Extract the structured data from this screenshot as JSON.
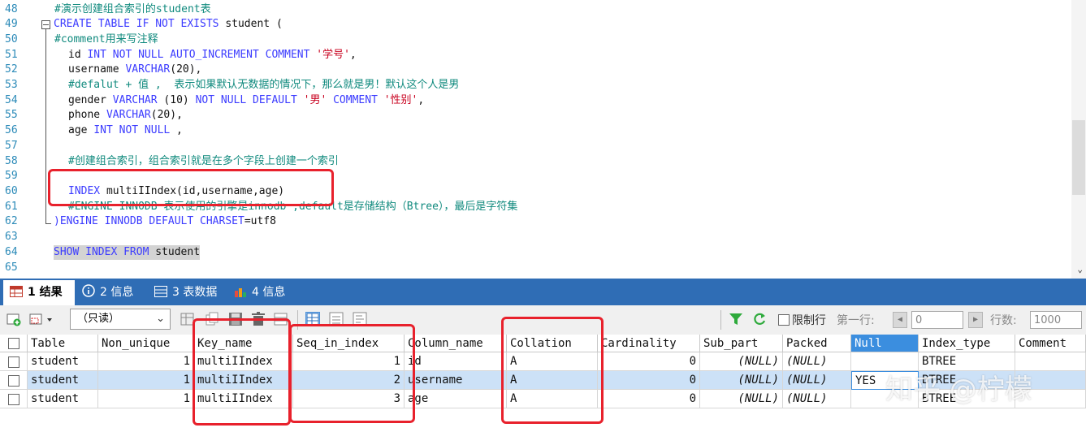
{
  "editor": {
    "line_numbers": [
      "48",
      "49",
      "50",
      "51",
      "52",
      "53",
      "54",
      "55",
      "56",
      "57",
      "58",
      "59",
      "60",
      "61",
      "62",
      "63",
      "64",
      "65"
    ],
    "lines": {
      "l48": "#演示创建组合索引的student表",
      "l49_kw": "CREATE TABLE IF NOT EXISTS",
      "l49_rest": " student (",
      "l50": "#comment用来写注释",
      "l51_a": "id ",
      "l51_kw": "INT NOT NULL AUTO_INCREMENT COMMENT",
      "l51_str": "'学号'",
      "l51_end": ",",
      "l52_a": "username ",
      "l52_kw": "VARCHAR",
      "l52_end": "(20),",
      "l53": "#defalut + 值 ,  表示如果默认无数据的情况下，那么就是男！默认这个人是男",
      "l54_a": "gender ",
      "l54_kw1": "VARCHAR",
      "l54_b": " (10) ",
      "l54_kw2": "NOT NULL DEFAULT",
      "l54_str1": "'男'",
      "l54_kw3": "COMMENT",
      "l54_str2": "'性别'",
      "l54_end": ",",
      "l55_a": "phone ",
      "l55_kw": "VARCHAR",
      "l55_end": "(20),",
      "l56_a": "age ",
      "l56_kw": "INT NOT NULL",
      "l56_end": " ,",
      "l58": "#创建组合索引，组合索引就是在多个字段上创建一个索引",
      "l60_kw": "INDEX",
      "l60_rest": " multiIIndex(id,username,age)",
      "l61": "#ENGINE INNODB 表示使用的引擎是innodb ,default是存储结构（Btree），最后是字符集",
      "l62_a": ")",
      "l62_kw": "ENGINE INNODB DEFAULT CHARSET",
      "l62_end": "=utf8",
      "l64_kw": "SHOW INDEX FROM",
      "l64_rest": " student"
    }
  },
  "tabs": [
    {
      "label": "1 结果",
      "icon": "table-icon",
      "active": true
    },
    {
      "label": "2 信息",
      "icon": "info-icon",
      "active": false
    },
    {
      "label": "3 表数据",
      "icon": "table-data-icon",
      "active": false
    },
    {
      "label": "4 信息",
      "icon": "chart-icon",
      "active": false
    }
  ],
  "toolbar": {
    "readonly_value": "（只读）",
    "limit_label": "限制行",
    "first_row_label": "第一行:",
    "first_row_value": "0",
    "rows_label": "行数:",
    "rows_value": "1000"
  },
  "grid": {
    "columns": [
      "Table",
      "Non_unique",
      "Key_name",
      "Seq_in_index",
      "Column_name",
      "Collation",
      "Cardinality",
      "Sub_part",
      "Packed",
      "Null",
      "Index_type",
      "Comment"
    ],
    "rows": [
      {
        "Table": "student",
        "Non_unique": "1",
        "Key_name": "multiIIndex",
        "Seq_in_index": "1",
        "Column_name": "id",
        "Collation": "A",
        "Cardinality": "0",
        "Sub_part": "(NULL)",
        "Packed": "(NULL)",
        "Null": "",
        "Index_type": "BTREE",
        "Comment": ""
      },
      {
        "Table": "student",
        "Non_unique": "1",
        "Key_name": "multiIIndex",
        "Seq_in_index": "2",
        "Column_name": "username",
        "Collation": "A",
        "Cardinality": "0",
        "Sub_part": "(NULL)",
        "Packed": "(NULL)",
        "Null": "YES",
        "Index_type": "BTREE",
        "Comment": ""
      },
      {
        "Table": "student",
        "Non_unique": "1",
        "Key_name": "multiIIndex",
        "Seq_in_index": "3",
        "Column_name": "age",
        "Collation": "A",
        "Cardinality": "0",
        "Sub_part": "(NULL)",
        "Packed": "(NULL)",
        "Null": "",
        "Index_type": "BTREE",
        "Comment": ""
      }
    ]
  },
  "watermark": "知乎 @柠檬",
  "colors": {
    "accent": "#2f6db5",
    "highlight_box": "#e8212c",
    "keyword": "#3c3cff",
    "comment": "#108a7e",
    "string": "#c8001e",
    "selected_row": "#cce1f7"
  }
}
